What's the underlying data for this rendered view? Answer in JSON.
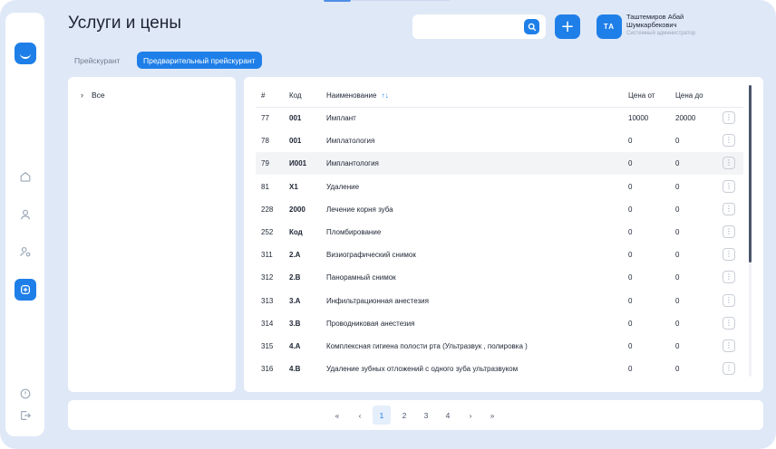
{
  "header": {
    "title": "Услуги и цены",
    "search_placeholder": "",
    "add_label": "+",
    "user": {
      "initials": "ТА",
      "name": "Таштемиров Абай Шумкарбекович",
      "role": "Системный администратор"
    }
  },
  "tabs": [
    {
      "label": "Прейскурант",
      "active": false
    },
    {
      "label": "Предварительный прейскурант",
      "active": true
    }
  ],
  "categories": [
    {
      "label": "Все"
    }
  ],
  "table": {
    "columns": [
      "#",
      "Код",
      "Наименование",
      "Цена от",
      "Цена до"
    ],
    "sort_indicator": "↑↓",
    "rows": [
      {
        "num": "77",
        "code": "001",
        "name": "Имплант",
        "from": "10000",
        "to": "20000"
      },
      {
        "num": "78",
        "code": "001",
        "name": "Имплатология",
        "from": "0",
        "to": "0"
      },
      {
        "num": "79",
        "code": "И001",
        "name": "Имплантология",
        "from": "0",
        "to": "0"
      },
      {
        "num": "81",
        "code": "X1",
        "name": "Удаление",
        "from": "0",
        "to": "0"
      },
      {
        "num": "228",
        "code": "2000",
        "name": "Лечение корня зуба",
        "from": "0",
        "to": "0"
      },
      {
        "num": "252",
        "code": "Код",
        "name": "Пломбирование",
        "from": "0",
        "to": "0"
      },
      {
        "num": "311",
        "code": "2.A",
        "name": "Визиографический снимок",
        "from": "0",
        "to": "0"
      },
      {
        "num": "312",
        "code": "2.B",
        "name": "Панорамный снимок",
        "from": "0",
        "to": "0"
      },
      {
        "num": "313",
        "code": "3.A",
        "name": "Инфильтрационная анестезия",
        "from": "0",
        "to": "0"
      },
      {
        "num": "314",
        "code": "3.B",
        "name": "Проводниковая анестезия",
        "from": "0",
        "to": "0"
      },
      {
        "num": "315",
        "code": "4.A",
        "name": "Комплексная гигиена полости рта (Ультразвук , полировка )",
        "from": "0",
        "to": "0"
      },
      {
        "num": "316",
        "code": "4.B",
        "name": "Удаление зубных отложений с одного зуба ультразвуком",
        "from": "0",
        "to": "0"
      }
    ],
    "highlighted_row": 2,
    "row_menu_icon": "⋮"
  },
  "pagination": {
    "first": "«",
    "prev": "‹",
    "pages": [
      "1",
      "2",
      "3",
      "4"
    ],
    "current": "1",
    "next": "›",
    "last": "»"
  },
  "colors": {
    "accent": "#1f7fe8",
    "background": "#dfe8f7"
  },
  "sidebar_icons": [
    "logo-icon",
    "home-icon",
    "user-icon",
    "users-settings-icon",
    "services-icon",
    "info-icon",
    "logout-icon"
  ]
}
